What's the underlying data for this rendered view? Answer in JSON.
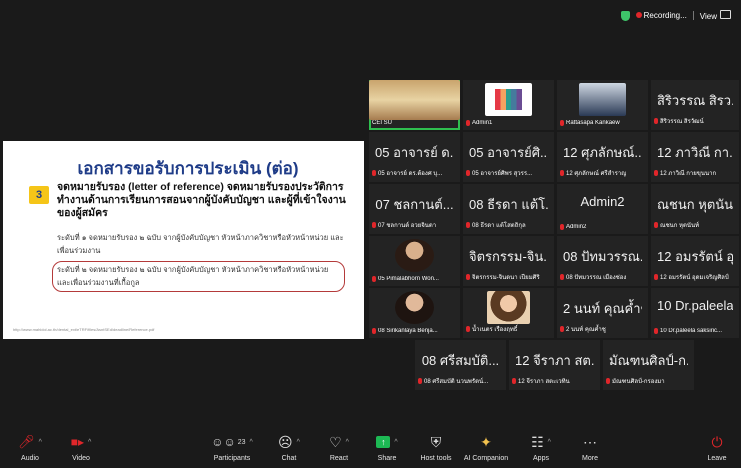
{
  "topbar": {
    "recording": "Recording...",
    "view": "View"
  },
  "slide": {
    "title": "เอกสารขอรับการประเมิน (ต่อ)",
    "number": "3",
    "heading": "จดหมายรับรอง (letter of reference) จดหมายรับรองประวัติการทำงานด้านการเรียนการสอนจากผู้บังคับบัญชา และผู้ที่เข้าใจงานของผู้สมัคร",
    "line1": "ระดับที่ ๑ จดหมายรับรอง ๒ ฉบับ จากผู้บังคับบัญชา หัวหน้าภาควิชาหรือหัวหน้าหน่วย และเพื่อนร่วมงาน",
    "line2": "ระดับที่ ๒ จดหมายรับรอง ๒ ฉบับ จากผู้บังคับบัญชา หัวหน้าภาควิชาหรือหัวหน้าหน่วย และเพื่อนร่วมงานที่เกื้อกูล",
    "footer": "http://www.mahidol.ac.th/dental_ext/eTRF/files/AsntSEd/deadline/Reference.pdf"
  },
  "tiles": [
    {
      "name": "",
      "label": "CEI SU"
    },
    {
      "name": "",
      "label": "Admin1"
    },
    {
      "name": "",
      "label": "Rattasapa Kankaew"
    },
    {
      "name": "สิริวรรณ สิรว...",
      "label": "สิริวรรณ สิรวัฒน์"
    },
    {
      "name": "05 อาจารย์ ด...",
      "label": "05 อาจารย์ ดร.ต้องศ บุ..."
    },
    {
      "name": "05 อาจารย์ศิ...",
      "label": "05 อาจารย์ศิพร สุวรร..."
    },
    {
      "name": "12 ศุภลักษณ์...",
      "label": "12 ศุภลักษณ์ ศรีสำราญ"
    },
    {
      "name": "12 ภาวิณี กา...",
      "label": "12 ภาวิณี กายขุนนาก"
    },
    {
      "name": "07 ชลกานต์...",
      "label": "07 ชลกานต์ อวยจินดา"
    },
    {
      "name": "08 ธีรดา แต้โ...",
      "label": "08 ธีรดา แต้โสตถิกุล"
    },
    {
      "name": "Admin2",
      "label": "Admin2"
    },
    {
      "name": "ณชนก หุตนันท์",
      "label": "ณชนก หุตนันท์"
    },
    {
      "name": "",
      "label": "05 Pimalabhorn Won..."
    },
    {
      "name": "จิตรกรรม-จิน...",
      "label": "จิตรกรรม-จินดนา เปียมศิริ"
    },
    {
      "name": "08 ปัทมวรรณ...",
      "label": "08 ปัทมวรรณ เมืองช่อง"
    },
    {
      "name": "12 อมรรัตน์ อุ...",
      "label": "12 อมรรัตน์ อุดมเจริญศิลป์"
    },
    {
      "name": "",
      "label": "08 Sirikanlaya Benja..."
    },
    {
      "name": "",
      "label": "น้ำเนตร เรืองฤทธิ์"
    },
    {
      "name": "2 นนท์ คุณค้ำชู",
      "label": "2 นนท์ คุณค้ำชู"
    },
    {
      "name": "10 Dr.paleela...",
      "label": "10 Dr.paleela saksiric..."
    },
    {
      "name": "08 ศรีสมบัติ...",
      "label": "08 ศรีสมบัติ นวนพรัตน์..."
    },
    {
      "name": "12 จีราภา สต...",
      "label": "12 จีราภา สตะเวทิน"
    },
    {
      "name": "มัณฑนศิลป์-ก...",
      "label": "มัณฑนศิลป์-กรองมา"
    }
  ],
  "toolbar": {
    "audio": "Audio",
    "video": "Video",
    "participants": "Participants",
    "participant_count": "23",
    "chat": "Chat",
    "react": "React",
    "share": "Share",
    "host_tools": "Host tools",
    "ai_companion": "AI Companion",
    "apps": "Apps",
    "more": "More",
    "leave": "Leave"
  }
}
